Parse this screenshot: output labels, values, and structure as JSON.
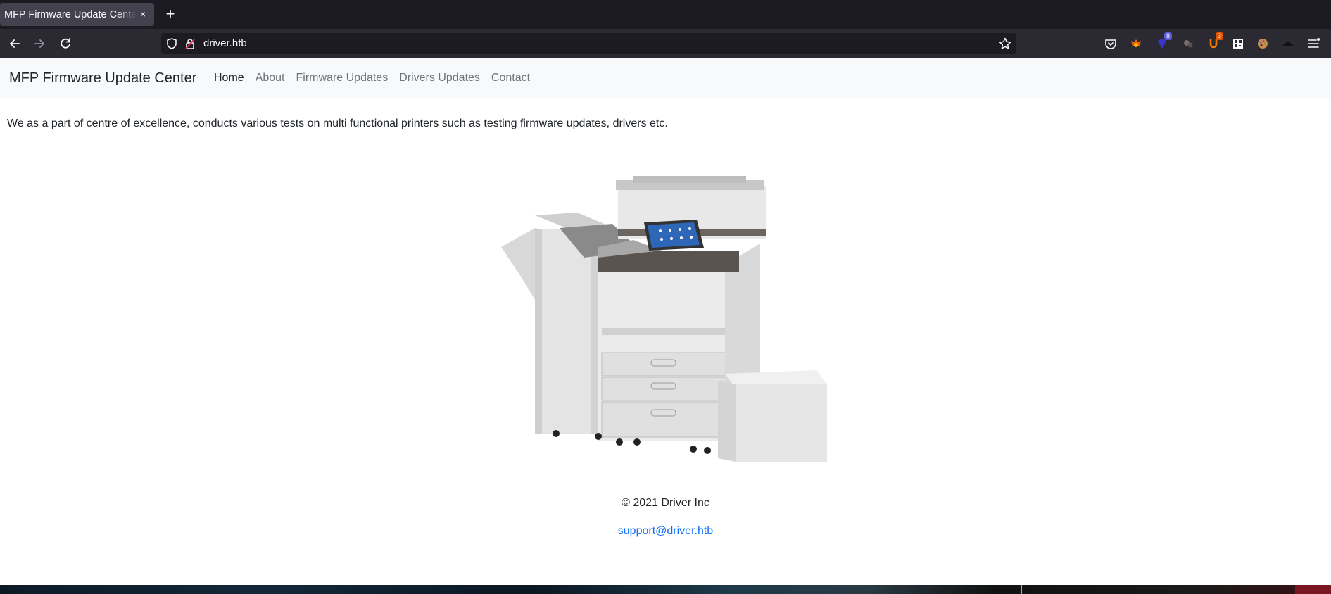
{
  "browser": {
    "tab_title": "MFP Firmware Update Center",
    "tab_close": "×",
    "new_tab": "+",
    "url": "driver.htb",
    "badges": {
      "ublock": "8",
      "other": "3"
    }
  },
  "site": {
    "brand": "MFP Firmware Update Center",
    "nav": [
      {
        "label": "Home",
        "active": true
      },
      {
        "label": "About"
      },
      {
        "label": "Firmware Updates"
      },
      {
        "label": "Drivers Updates"
      },
      {
        "label": "Contact"
      }
    ],
    "intro": "We as a part of centre of excellence, conducts various tests on multi functional printers such as testing firmware updates, drivers etc.",
    "copyright": "© 2021 Driver Inc",
    "support_email": "support@driver.htb"
  },
  "colors": {
    "chrome_dark": "#1c1b22",
    "chrome_toolbar": "#2b2a33",
    "nav_bg": "#f8f9fa",
    "link_blue": "#0d6efd",
    "nav_muted": "#6c757d"
  }
}
